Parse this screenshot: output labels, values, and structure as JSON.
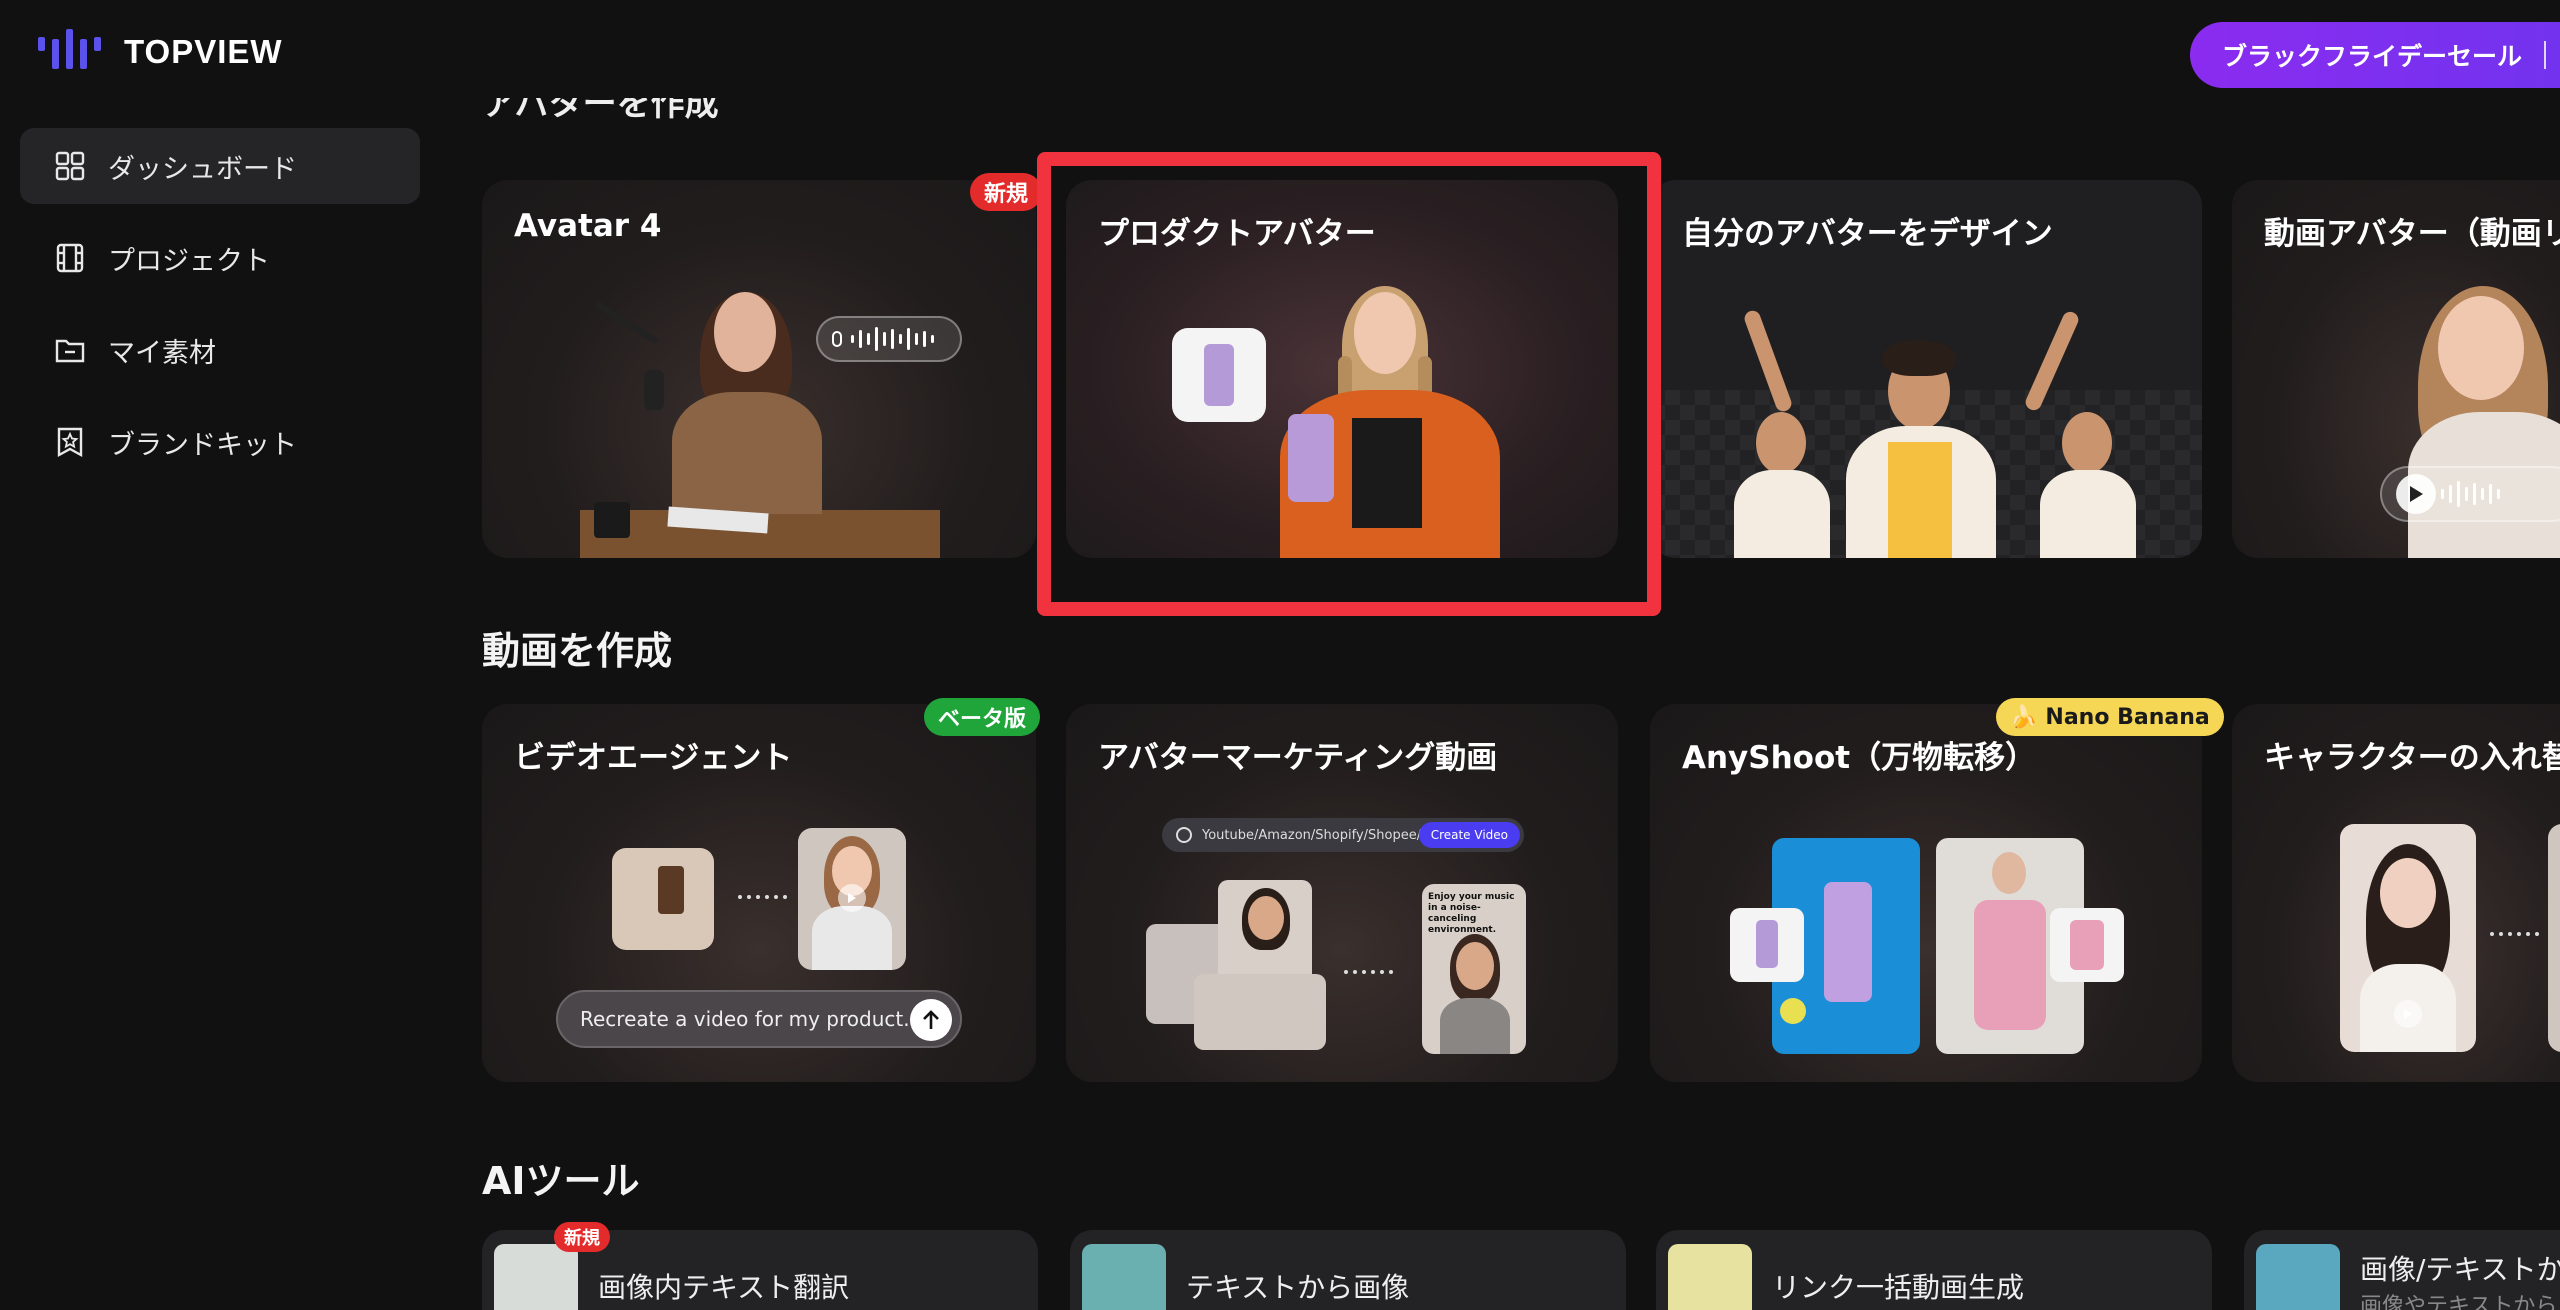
{
  "brand": {
    "name": "TOPVIEW"
  },
  "sidebar": {
    "items": [
      {
        "label": "ダッシュボード",
        "icon": "grid-icon",
        "active": true
      },
      {
        "label": "プロジェクト",
        "icon": "film-icon",
        "active": false
      },
      {
        "label": "マイ素材",
        "icon": "folder-icon",
        "active": false
      },
      {
        "label": "ブランドキット",
        "icon": "star-bookmark-icon",
        "active": false
      }
    ]
  },
  "header": {
    "promo_label": "ブラックフライデーセール"
  },
  "sections": {
    "avatar": {
      "title": "アバターを作成"
    },
    "video": {
      "title": "動画を作成"
    },
    "tools": {
      "title": "AIツール"
    }
  },
  "avatar_cards": [
    {
      "title": "Avatar 4",
      "badge": "新規"
    },
    {
      "title": "プロダクトアバター"
    },
    {
      "title": "自分のアバターをデザイン"
    },
    {
      "title": "動画アバター（動画リ"
    }
  ],
  "video_cards": [
    {
      "title": "ビデオエージェント",
      "badge": "ベータ版",
      "prompt": "Recreate a video for my product..."
    },
    {
      "title": "アバターマーケティング動画",
      "url_text": "Youtube/Amazon/Shopify/Shopee/TikTok...",
      "url_button": "Create Video",
      "phone_caption": "Enjoy your music in a noise-canceling environment."
    },
    {
      "title": "AnyShoot（万物転移）",
      "badge": "Nano Banana"
    },
    {
      "title": "キャラクターの入れ替"
    }
  ],
  "tool_cards": [
    {
      "label": "画像内テキスト翻訳",
      "badge": "新規"
    },
    {
      "label": "テキストから画像"
    },
    {
      "label": "リンク一括動画生成"
    },
    {
      "label": "画像/テキストか",
      "sub": "画像やテキストから"
    }
  ],
  "colors": {
    "accent": "#5a52ea",
    "promo_start": "#8b2cf0",
    "highlight": "#f1323f",
    "badge_red": "#e32b2b",
    "badge_green": "#1fa53a",
    "badge_yellow": "#f5d655"
  }
}
